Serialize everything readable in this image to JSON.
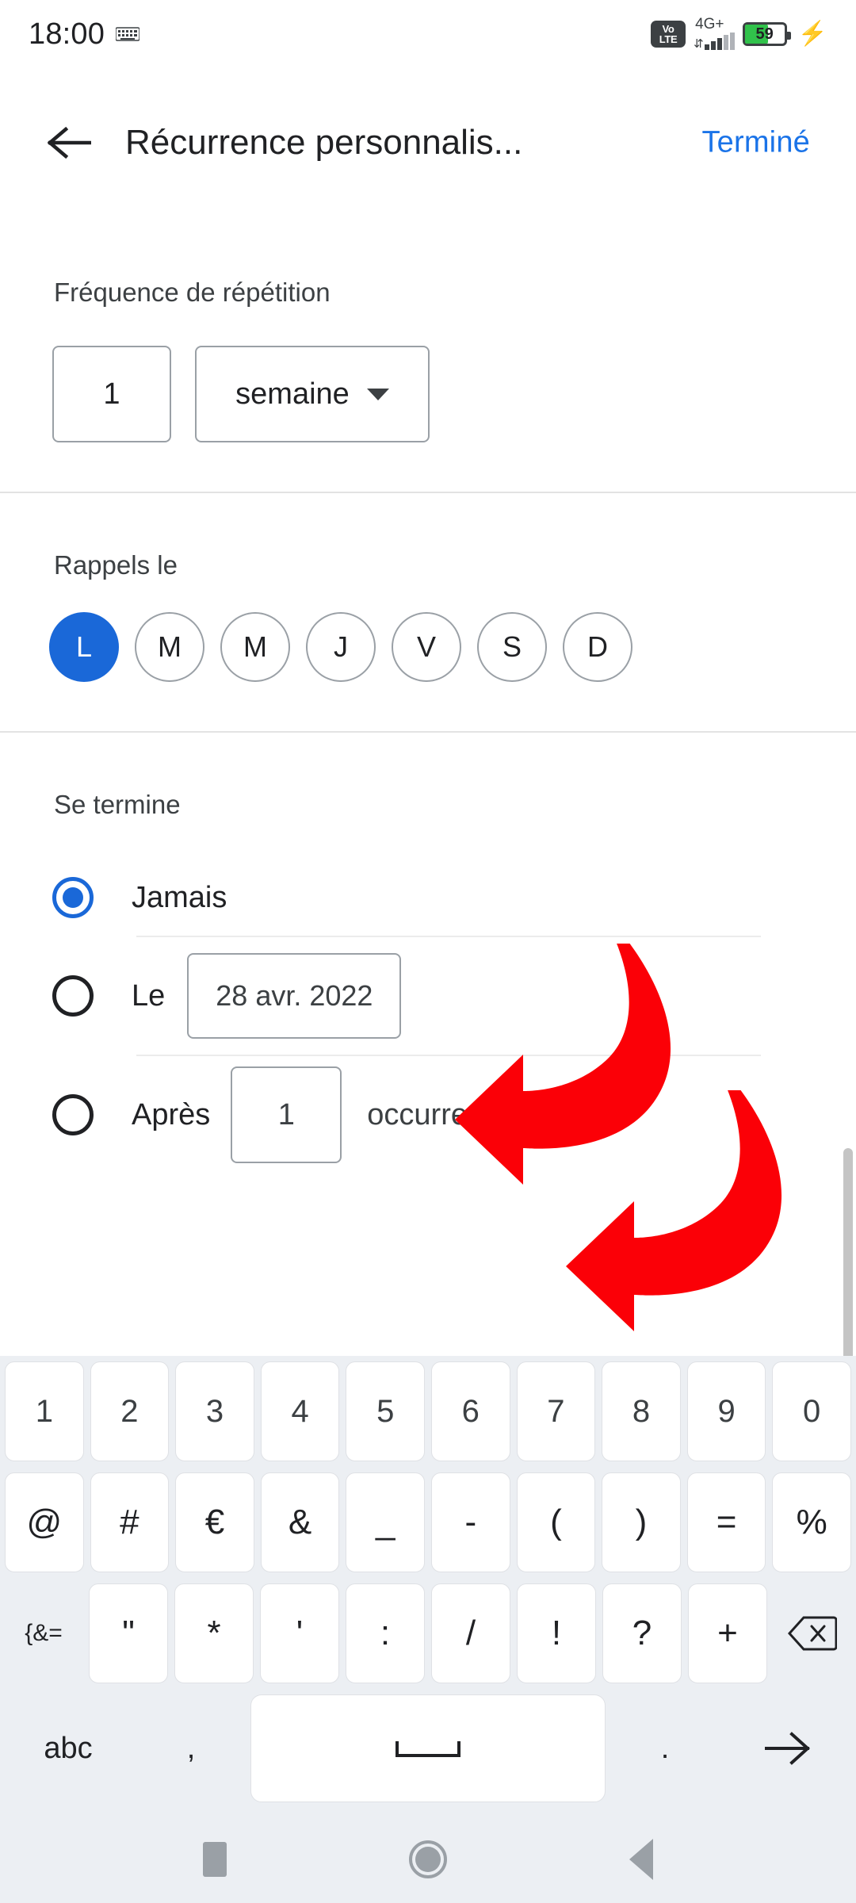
{
  "status_bar": {
    "time": "18:00",
    "keyboard_indicator_icon": "keyboard-icon",
    "volte_top": "Vo",
    "volte_bottom": "LTE",
    "network": "4G+",
    "battery_percent": "59",
    "battery_level": 59,
    "battery_color": "#31c24b",
    "charging_icon": "bolt-icon"
  },
  "app_bar": {
    "back_icon": "arrow-left-icon",
    "title": "Récurrence personnalis...",
    "done_label": "Terminé",
    "accent_color": "#1a73e8"
  },
  "frequency": {
    "label": "Fréquence de répétition",
    "count_value": "1",
    "unit_value": "semaine",
    "dropdown_icon": "chevron-down-icon"
  },
  "days": {
    "label": "Rappels le",
    "chips": [
      {
        "label": "L",
        "selected": true
      },
      {
        "label": "M",
        "selected": false
      },
      {
        "label": "M",
        "selected": false
      },
      {
        "label": "J",
        "selected": false
      },
      {
        "label": "V",
        "selected": false
      },
      {
        "label": "S",
        "selected": false
      },
      {
        "label": "D",
        "selected": false
      }
    ],
    "selected_color": "#1a68d8"
  },
  "ends": {
    "label": "Se termine",
    "never_label": "Jamais",
    "never_selected": true,
    "on_label": "Le",
    "on_date_value": "28 avr. 2022",
    "on_selected": false,
    "after_label": "Après",
    "after_count_value": "1",
    "after_unit_label": "occurrence",
    "after_selected": false
  },
  "annotations": {
    "arrow_color": "#fb0007",
    "arrows": [
      {
        "name": "arrow-to-date-field",
        "direction": "left"
      },
      {
        "name": "arrow-to-occurrence-field",
        "direction": "left"
      }
    ]
  },
  "keyboard": {
    "row1": [
      "1",
      "2",
      "3",
      "4",
      "5",
      "6",
      "7",
      "8",
      "9",
      "0"
    ],
    "row2": [
      "@",
      "#",
      "€",
      "&",
      "_",
      "-",
      "(",
      ")",
      "=",
      "%"
    ],
    "row3_modifier": "{&=",
    "row3": [
      "\"",
      "*",
      "'",
      ":",
      "/",
      "!",
      "?",
      "+"
    ],
    "row3_backspace_icon": "backspace-icon",
    "row4": {
      "abc_label": "abc",
      "comma_label": ",",
      "space_icon": "space-icon",
      "period_label": ".",
      "enter_icon": "arrow-right-icon"
    }
  },
  "nav_bar": {
    "recents_icon": "square-recents-icon",
    "home_icon": "circle-home-icon",
    "back_icon": "triangle-back-icon"
  }
}
